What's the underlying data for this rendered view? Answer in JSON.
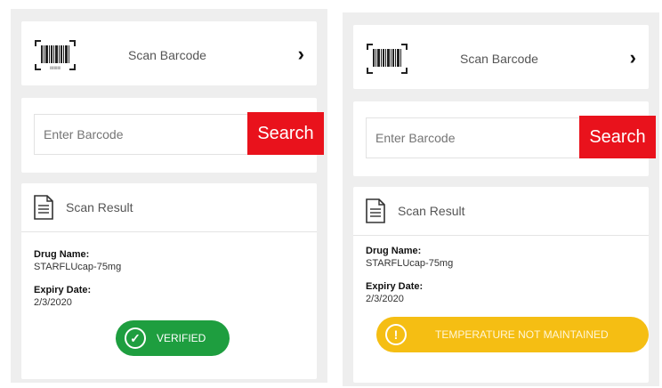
{
  "screens": [
    {
      "scan": {
        "label": "Scan Barcode",
        "barcode_icon": "barcode-icon",
        "chevron": "›"
      },
      "search": {
        "placeholder": "Enter Barcode",
        "button": "Search"
      },
      "result": {
        "title": "Scan Result",
        "drug_name_label": "Drug Name:",
        "drug_name_value": "STARFLUcap-75mg",
        "expiry_label": "Expiry Date:",
        "expiry_value": "2/3/2020",
        "status": "VERIFIED",
        "status_icon": "✓",
        "status_color": "#1e9e3f"
      }
    },
    {
      "scan": {
        "label": "Scan Barcode",
        "barcode_icon": "barcode-icon",
        "chevron": "›"
      },
      "search": {
        "placeholder": "Enter Barcode",
        "button": "Search"
      },
      "result": {
        "title": "Scan Result",
        "drug_name_label": "Drug Name:",
        "drug_name_value": "STARFLUcap-75mg",
        "expiry_label": "Expiry Date:",
        "expiry_value": "2/3/2020",
        "status": "TEMPERATURE NOT MAINTAINED",
        "status_icon": "!",
        "status_color": "#f5be13"
      }
    }
  ],
  "accent": "#e9121c"
}
